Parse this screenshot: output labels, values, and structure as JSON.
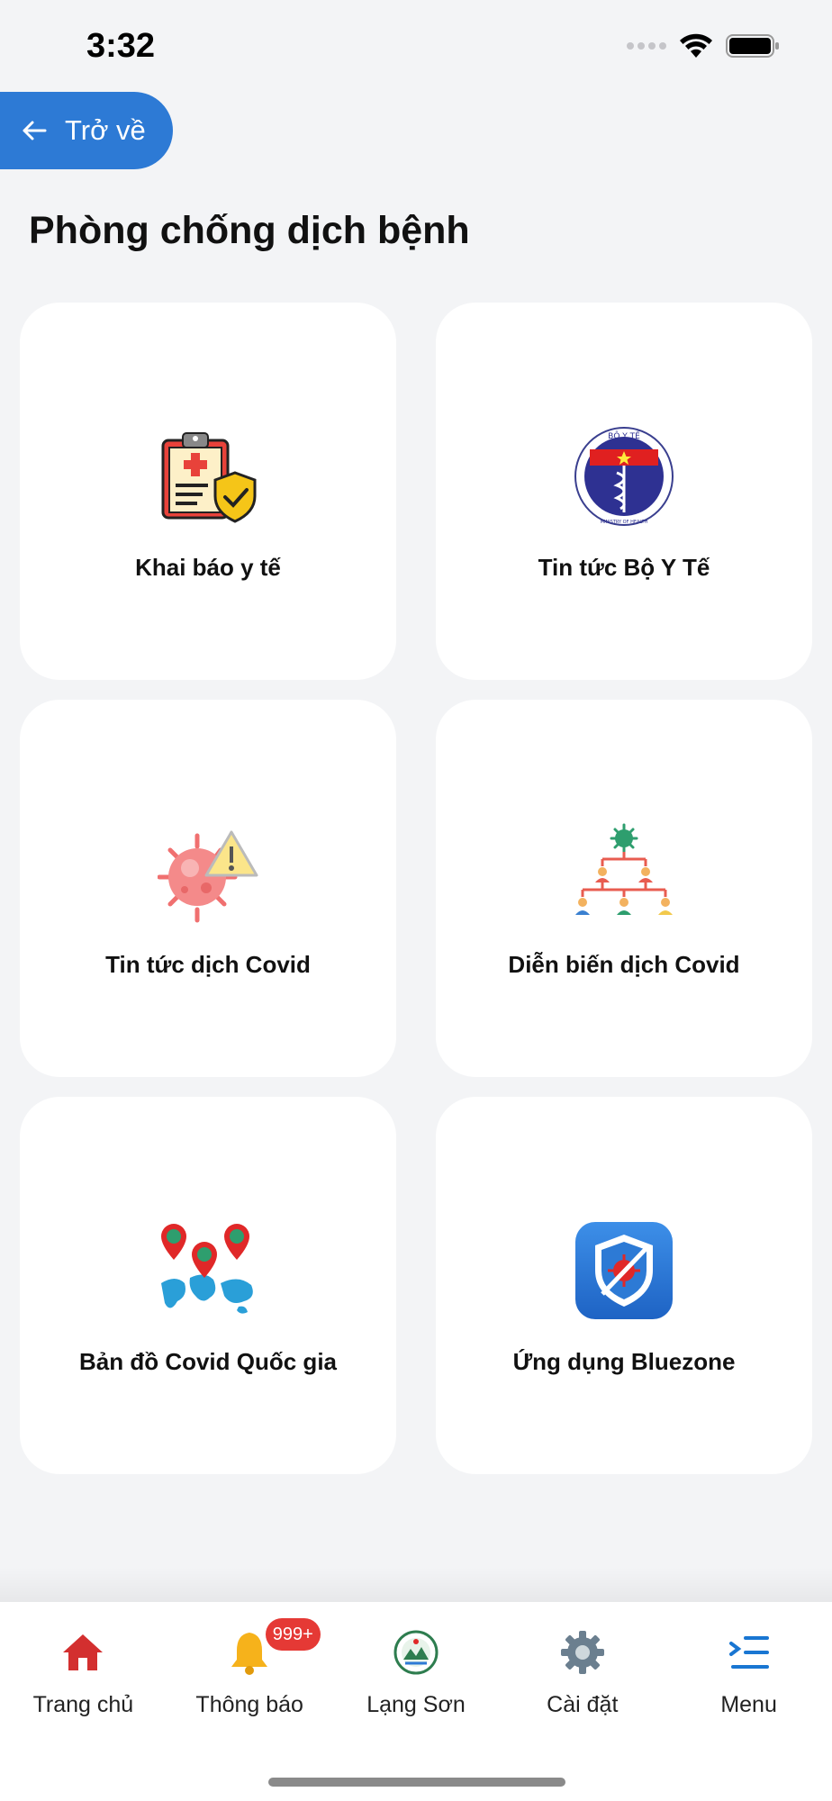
{
  "status_bar": {
    "time": "3:32"
  },
  "header": {
    "back_label": "Trở về",
    "title": "Phòng chống dịch bệnh"
  },
  "cards": [
    {
      "label": "Khai báo y tế",
      "icon": "medical-declaration-icon"
    },
    {
      "label": "Tin tức Bộ Y Tế",
      "icon": "ministry-of-health-logo"
    },
    {
      "label": "Tin tức dịch Covid",
      "icon": "covid-warning-icon"
    },
    {
      "label": "Diễn biến dịch Covid",
      "icon": "covid-spread-tree-icon"
    },
    {
      "label": "Bản đồ Covid Quốc gia",
      "icon": "covid-map-icon"
    },
    {
      "label": "Ứng dụng Bluezone",
      "icon": "bluezone-app-icon"
    }
  ],
  "moh_logo_text": {
    "top": "BỘ Y TẾ",
    "bottom": "MINISTRY OF HEALTH"
  },
  "tab_bar": {
    "items": [
      {
        "label": "Trang chủ",
        "icon": "home-icon"
      },
      {
        "label": "Thông báo",
        "icon": "bell-icon",
        "badge": "999+"
      },
      {
        "label": "Lạng Sơn",
        "icon": "lang-son-emblem-icon"
      },
      {
        "label": "Cài đặt",
        "icon": "gear-icon"
      },
      {
        "label": "Menu",
        "icon": "menu-icon"
      }
    ]
  },
  "colors": {
    "accent": "#2d7ad5",
    "badge": "#e53935",
    "background": "#f3f4f6",
    "home_icon": "#d32f2f"
  }
}
